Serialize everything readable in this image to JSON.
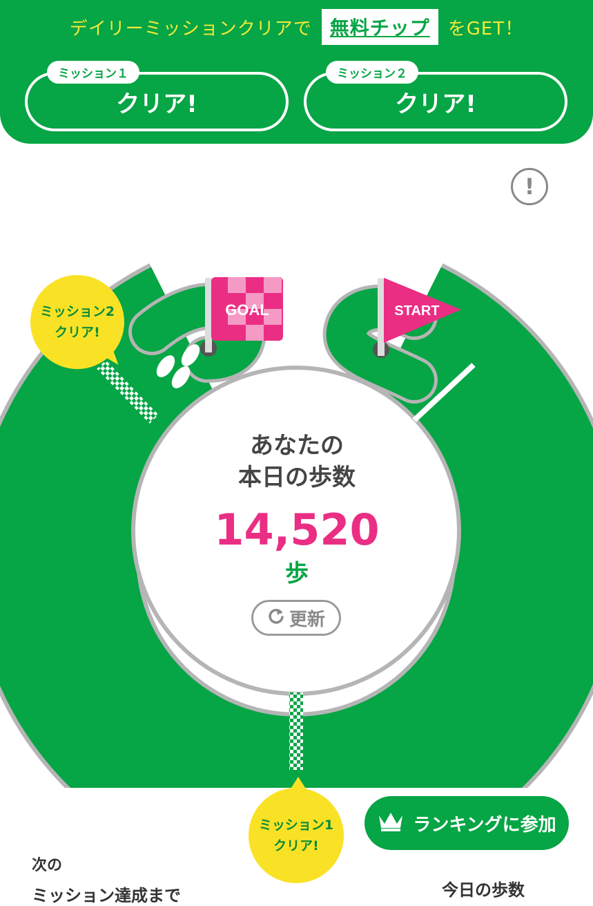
{
  "header": {
    "promo_prefix": "デイリーミッションクリアで",
    "promo_link": "無料チップ",
    "promo_suffix": "をGET！",
    "missions": [
      {
        "tag": "ミッション１",
        "status": "クリア!"
      },
      {
        "tag": "ミッション２",
        "status": "クリア!"
      }
    ]
  },
  "info_icon": "!",
  "course": {
    "goal_label": "GOAL",
    "start_label": "START",
    "mission2_bubble": [
      "ミッション2",
      "クリア!"
    ],
    "mission1_bubble": [
      "ミッション1",
      "クリア!"
    ]
  },
  "center": {
    "label_line1": "あなたの",
    "label_line2": "本日の歩数",
    "steps": "14,520",
    "unit": "歩",
    "refresh_label": "更新",
    "refresh_icon": "refresh-icon"
  },
  "ranking": {
    "label": "ランキングに参加",
    "icon": "crown-icon"
  },
  "footer": {
    "next_label": "次の",
    "next_sub": "ミッション達成まで",
    "today_label": "今日の歩数"
  },
  "colors": {
    "green": "#06a545",
    "yellow": "#f9e225",
    "pink": "#ea2e84",
    "promo_yellow": "#f4ea3a"
  }
}
